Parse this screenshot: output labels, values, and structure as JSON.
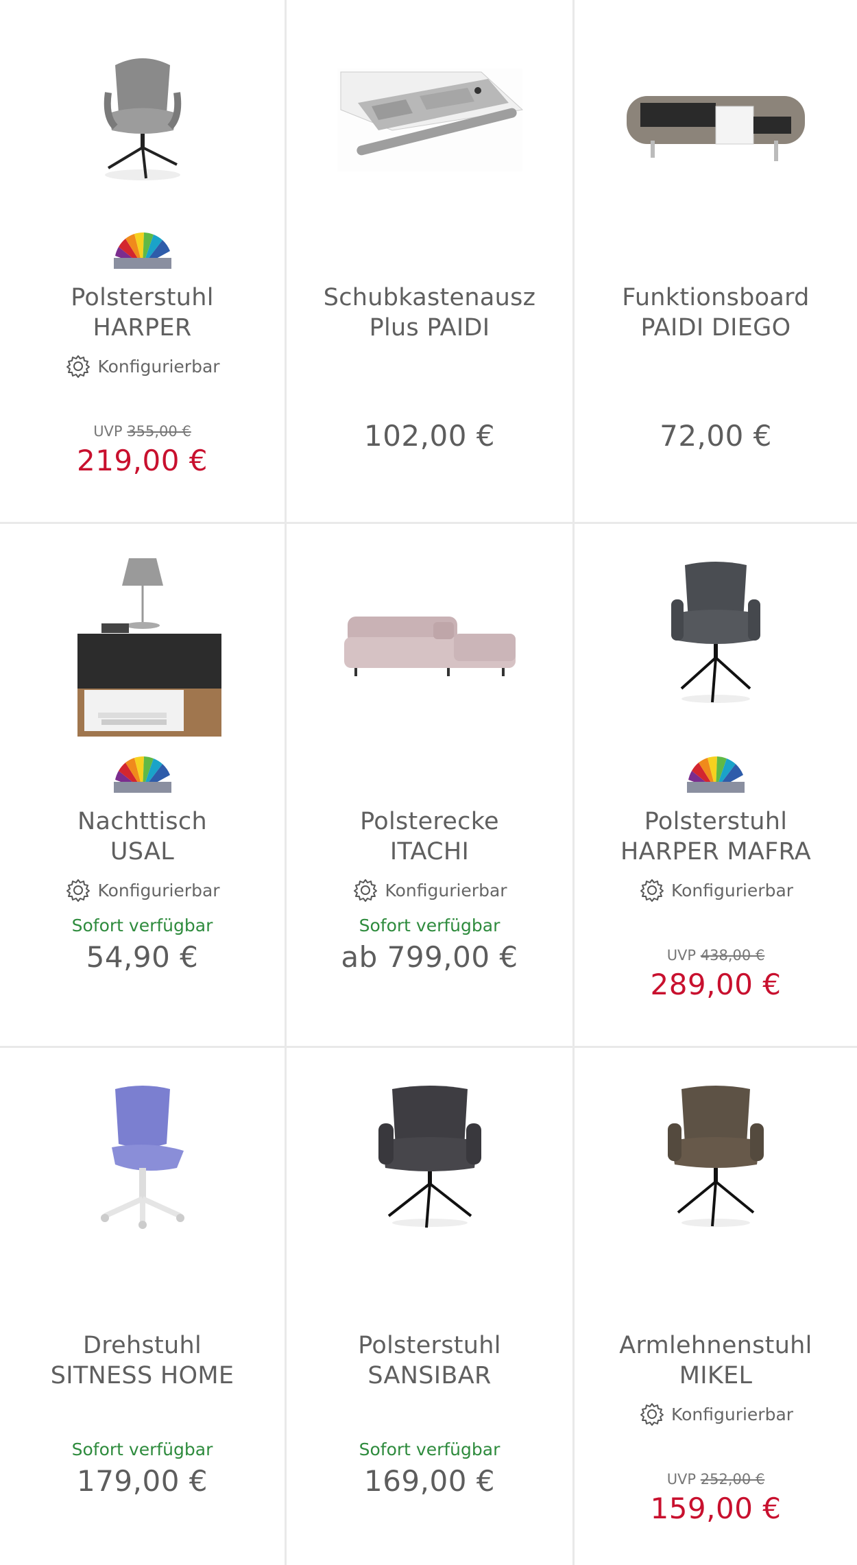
{
  "products": [
    {
      "title_line1": "Polsterstuhl",
      "title_line2": "HARPER",
      "configurable": "Konfigurierbar",
      "stock": "",
      "uvp_label": "UVP",
      "uvp_price": "355,00 €",
      "price": "219,00 €",
      "sale": true,
      "swatch": true,
      "image": "grey-swivel-chair"
    },
    {
      "title_line1": "Schubkastenausz",
      "title_line2": "Plus PAIDI",
      "configurable": "",
      "stock": "",
      "uvp_label": "",
      "uvp_price": "",
      "price": "102,00 €",
      "sale": false,
      "swatch": false,
      "image": "drawer-organizer"
    },
    {
      "title_line1": "Funktionsboard",
      "title_line2": "PAIDI DIEGO",
      "configurable": "",
      "stock": "",
      "uvp_label": "",
      "uvp_price": "",
      "price": "72,00 €",
      "sale": false,
      "swatch": false,
      "image": "wall-shelf-board"
    },
    {
      "title_line1": "Nachttisch",
      "title_line2": "USAL",
      "configurable": "Konfigurierbar",
      "stock": "Sofort verfügbar",
      "uvp_label": "",
      "uvp_price": "",
      "price": "54,90 €",
      "sale": false,
      "swatch": true,
      "image": "nightstand-with-lamp"
    },
    {
      "title_line1": "Polsterecke",
      "title_line2": "ITACHI",
      "configurable": "Konfigurierbar",
      "stock": "Sofort verfügbar",
      "uvp_label": "",
      "uvp_price": "",
      "price": "ab 799,00 €",
      "sale": false,
      "swatch": false,
      "image": "pink-corner-sofa"
    },
    {
      "title_line1": "Polsterstuhl",
      "title_line2": "HARPER MAFRA",
      "configurable": "Konfigurierbar",
      "stock": "",
      "uvp_label": "UVP",
      "uvp_price": "438,00 €",
      "price": "289,00 €",
      "sale": true,
      "swatch": true,
      "image": "dark-grey-armchair"
    },
    {
      "title_line1": "Drehstuhl",
      "title_line2": "SITNESS HOME",
      "configurable": "",
      "stock": "Sofort verfügbar",
      "uvp_label": "",
      "uvp_price": "",
      "price": "179,00 €",
      "sale": false,
      "swatch": false,
      "image": "blue-kids-office-chair"
    },
    {
      "title_line1": "Polsterstuhl",
      "title_line2": "SANSIBAR",
      "configurable": "",
      "stock": "Sofort verfügbar",
      "uvp_label": "",
      "uvp_price": "",
      "price": "169,00 €",
      "sale": false,
      "swatch": false,
      "image": "anthracite-armchair"
    },
    {
      "title_line1": "Armlehnenstuhl",
      "title_line2": "MIKEL",
      "configurable": "Konfigurierbar",
      "stock": "",
      "uvp_label": "UVP",
      "uvp_price": "252,00 €",
      "price": "159,00 €",
      "sale": true,
      "swatch": false,
      "image": "brown-armchair"
    }
  ],
  "colors": {
    "sale": "#c8102e",
    "stock": "#2e8b3d",
    "text": "#5f5f5f",
    "divider": "#e9e9e9"
  }
}
